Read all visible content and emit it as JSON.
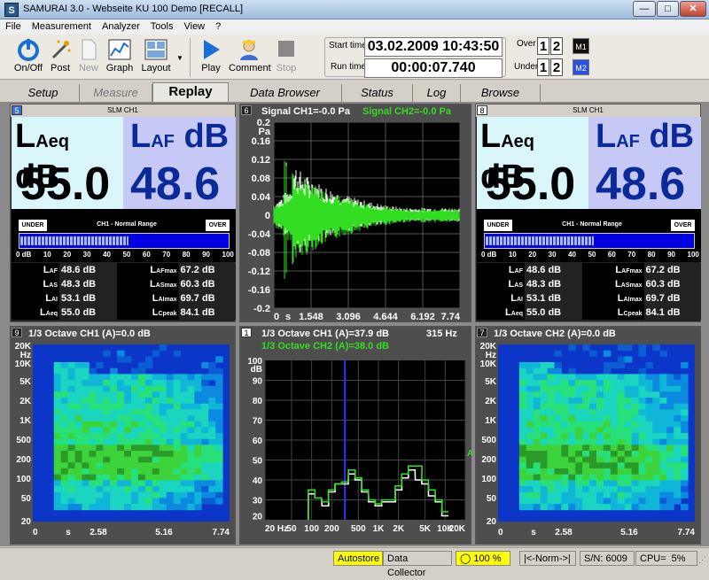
{
  "window": {
    "title": "SAMURAI 3.0 - Webseite KU 100 Demo [RECALL]",
    "icon_letter": "S"
  },
  "menu": [
    "File",
    "Measurement",
    "Analyzer",
    "Tools",
    "View",
    "?"
  ],
  "toolbar": {
    "buttons": [
      "On/Off",
      "Post",
      "New",
      "Graph",
      "Layout",
      "Play",
      "Comment",
      "Stop"
    ],
    "start_time_label": "Start time",
    "run_time_label": "Run time",
    "start_time": "03.02.2009 10:43:50",
    "run_time": "00:00:07.740",
    "over_label": "Over",
    "under_label": "Under",
    "over_digits": [
      "1",
      "2"
    ],
    "under_digits": [
      "1",
      "2"
    ],
    "m1": "M1",
    "m2": "M2"
  },
  "tabs": [
    "Setup",
    "Measure",
    "Replay",
    "Data Browser",
    "Status",
    "Log",
    "Browse"
  ],
  "active_tab": "Replay",
  "slm_left": {
    "num": "5",
    "header": "SLM CH1",
    "l1": "L",
    "l1_sub": "Aeq",
    "l1_unit": "dB",
    "l1_value": "55.0",
    "l2": "L",
    "l2_sub": "AF",
    "l2_unit": "dB",
    "l2_value": "48.6",
    "range_under": "UNDER",
    "range_title": "CH1 - Normal Range",
    "range_over": "OVER",
    "bar_level": 0.52,
    "scale": [
      "0 dB",
      "10",
      "20",
      "30",
      "40",
      "50",
      "60",
      "70",
      "80",
      "90",
      "100"
    ],
    "rows": [
      {
        "l": "L",
        "s": "AF",
        "v": "48.6 dB",
        "l2": "L",
        "s2": "AFmax",
        "v2": "67.2 dB"
      },
      {
        "l": "L",
        "s": "AS",
        "v": "48.3 dB",
        "l2": "L",
        "s2": "ASmax",
        "v2": "60.3 dB"
      },
      {
        "l": "L",
        "s": "AI",
        "v": "53.1 dB",
        "l2": "L",
        "s2": "AImax",
        "v2": "69.7 dB"
      },
      {
        "l": "L",
        "s": "Aeq",
        "v": "55.0 dB",
        "l2": "L",
        "s2": "Cpeak",
        "v2": "84.1 dB"
      }
    ]
  },
  "slm_right": {
    "num": "8",
    "header": "SLM CH1",
    "l1": "L",
    "l1_sub": "Aeq",
    "l1_unit": "dB",
    "l1_value": "55.0",
    "l2": "L",
    "l2_sub": "AF",
    "l2_unit": "dB",
    "l2_value": "48.6",
    "range_under": "UNDER",
    "range_title": "CH1 - Normal Range",
    "range_over": "OVER",
    "bar_level": 0.52,
    "scale": [
      "0 dB",
      "10",
      "20",
      "30",
      "40",
      "50",
      "60",
      "70",
      "80",
      "90",
      "100"
    ],
    "rows": [
      {
        "l": "L",
        "s": "AF",
        "v": "48.6 dB",
        "l2": "L",
        "s2": "AFmax",
        "v2": "67.2 dB"
      },
      {
        "l": "L",
        "s": "AS",
        "v": "48.3 dB",
        "l2": "L",
        "s2": "ASmax",
        "v2": "60.3 dB"
      },
      {
        "l": "L",
        "s": "AI",
        "v": "53.1 dB",
        "l2": "L",
        "s2": "AImax",
        "v2": "69.7 dB"
      },
      {
        "l": "L",
        "s": "Aeq",
        "v": "55.0 dB",
        "l2": "L",
        "s2": "Cpeak",
        "v2": "84.1 dB"
      }
    ]
  },
  "signal": {
    "num": "6",
    "title1": "Signal CH1=-0.0 Pa",
    "title2": "Signal CH2=-0.0 Pa",
    "yticks": [
      "0.2",
      "0.16",
      "0.12",
      "0.08",
      "0.04",
      "0",
      "-0.04",
      "-0.08",
      "-0.12",
      "-0.16",
      "-0.2"
    ],
    "yunit": "Pa",
    "xticks": [
      "0",
      "s",
      "1.548",
      "3.096",
      "4.644",
      "6.192",
      "7.74"
    ]
  },
  "spec_left": {
    "num": "9",
    "title": "1/3 Octave CH1 (A)=0.0 dB",
    "yticks": [
      "20K",
      "Hz",
      "10K",
      "5K",
      "2K",
      "1K",
      "500",
      "200",
      "100",
      "50",
      "20"
    ],
    "xticks": [
      "0",
      "s",
      "2.58",
      "5.16",
      "7.74"
    ]
  },
  "spec_right": {
    "num": "7",
    "title": "1/3 Octave CH2 (A)=0.0 dB",
    "yticks": [
      "20K",
      "Hz",
      "10K",
      "5K",
      "2K",
      "1K",
      "500",
      "200",
      "100",
      "50",
      "20"
    ],
    "xticks": [
      "0",
      "s",
      "2.58",
      "5.16",
      "7.74"
    ]
  },
  "octave": {
    "num": "1",
    "title1": "1/3 Octave CH1 (A)=37.9 dB",
    "title2": "1/3 Octave CH2 (A)=38.0 dB",
    "cursor_label": "315 Hz",
    "yticks": [
      "100",
      "dB",
      "90",
      "80",
      "70",
      "60",
      "50",
      "40",
      "30",
      "20"
    ],
    "xticks": [
      "20 Hz",
      "50",
      "100",
      "200",
      "500",
      "1K",
      "2K",
      "5K",
      "10K",
      "20K"
    ],
    "marker_label": "A",
    "chart_data": {
      "type": "bar",
      "ylim": [
        20,
        100
      ],
      "cursor": "315 Hz",
      "series": [
        {
          "name": "1/3 Octave CH1 (A)=37.9 dB",
          "color": "#ffffff",
          "x": [
            100,
            125,
            160,
            200,
            250,
            315,
            400,
            500,
            630,
            800,
            1000,
            1250,
            1600,
            2000,
            2500,
            3150,
            4000,
            5000,
            6300,
            8000,
            10000
          ],
          "values": [
            33,
            31,
            27,
            34,
            38,
            38,
            43,
            40,
            34,
            29,
            27,
            29,
            29,
            35,
            41,
            45,
            40,
            38,
            32,
            29,
            22
          ]
        },
        {
          "name": "1/3 Octave CH2 (A)=38.0 dB",
          "color": "#33dd22",
          "x": [
            100,
            125,
            160,
            200,
            250,
            315,
            400,
            500,
            630,
            800,
            1000,
            1250,
            1600,
            2000,
            2500,
            3150,
            4000,
            5000,
            6300,
            8000,
            10000
          ],
          "values": [
            35,
            31,
            29,
            35,
            38,
            39,
            45,
            41,
            35,
            30,
            28,
            30,
            30,
            37,
            43,
            47,
            47,
            40,
            35,
            30,
            24
          ]
        }
      ]
    }
  },
  "status": {
    "autostore": "Autostore",
    "collector": "Data Collector",
    "battery": "100 %",
    "norm": "|<-Norm->|",
    "serial": "S/N: 6009",
    "cpu": "CPU=",
    "cpu_val": "5%"
  },
  "colors": {
    "accent": "#0b36c7",
    "green": "#33dd22",
    "lightblue": "#d9f6fb",
    "lavender": "#c6c8f6"
  }
}
